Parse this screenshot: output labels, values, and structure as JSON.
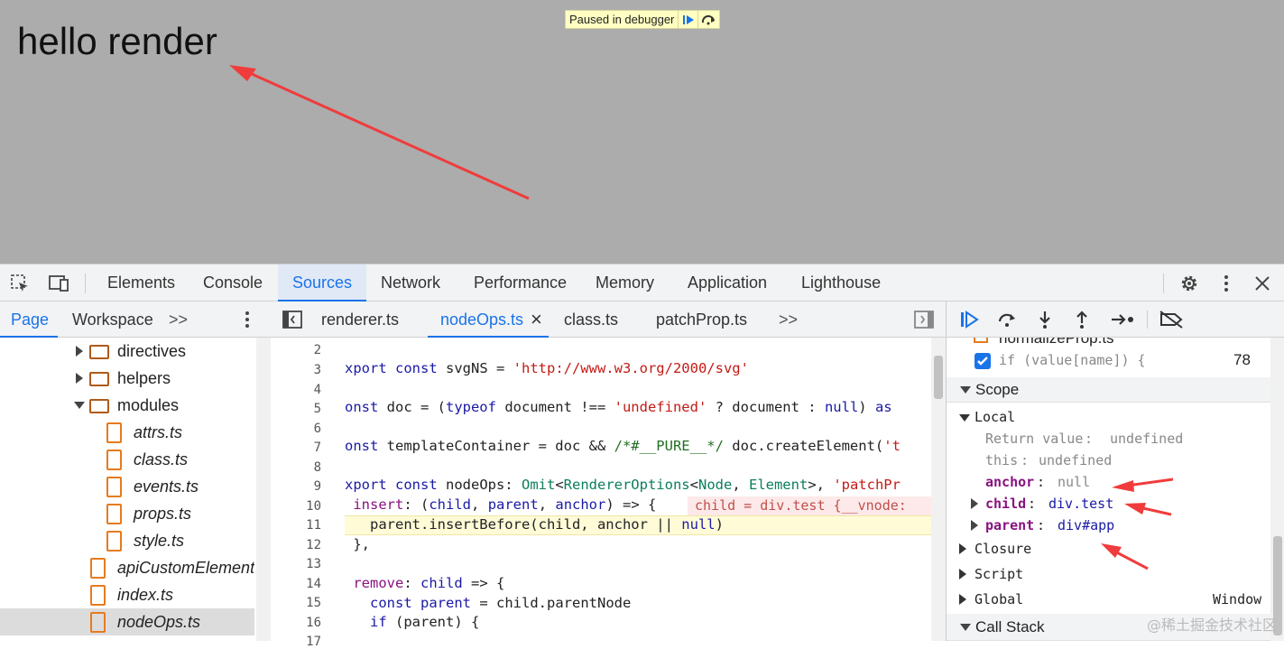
{
  "page": {
    "heading": "hello render"
  },
  "pause_banner": {
    "text": "Paused in debugger",
    "resume_icon": "resume-icon",
    "step_icon": "step-over-icon"
  },
  "devtools": {
    "tabs": [
      "Elements",
      "Console",
      "Sources",
      "Network",
      "Performance",
      "Memory",
      "Application",
      "Lighthouse"
    ],
    "active_tab": "Sources",
    "icons": [
      "inspect-element-icon",
      "device-toggle-icon",
      "settings-icon",
      "more-icon",
      "close-icon"
    ]
  },
  "navigator": {
    "tabs": [
      "Page",
      "Workspace"
    ],
    "active_tab": "Page",
    "more": ">>",
    "tree": [
      {
        "label": "directives",
        "kind": "folder",
        "expanded": false
      },
      {
        "label": "helpers",
        "kind": "folder",
        "expanded": false
      },
      {
        "label": "modules",
        "kind": "folder",
        "expanded": true
      },
      {
        "label": "attrs.ts",
        "kind": "file"
      },
      {
        "label": "class.ts",
        "kind": "file"
      },
      {
        "label": "events.ts",
        "kind": "file"
      },
      {
        "label": "props.ts",
        "kind": "file"
      },
      {
        "label": "style.ts",
        "kind": "file"
      },
      {
        "label": "apiCustomElement.t",
        "kind": "file"
      },
      {
        "label": "index.ts",
        "kind": "file"
      },
      {
        "label": "nodeOps.ts",
        "kind": "file",
        "selected": true
      }
    ]
  },
  "editor": {
    "tabs": [
      "renderer.ts",
      "nodeOps.ts",
      "class.ts",
      "patchProp.ts"
    ],
    "active_tab": "nodeOps.ts",
    "close_glyph": "×",
    "more": ">>",
    "line_numbers": [
      "2",
      "3",
      "4",
      "5",
      "6",
      "7",
      "8",
      "9",
      "10",
      "11",
      "12",
      "13",
      "14",
      "15",
      "16",
      "17"
    ],
    "inline_value": "child = div.test {__vnode:"
  },
  "debugger": {
    "breakpoint_file": "normalizeProp.ts",
    "breakpoint_code": "if (value[name]) {",
    "breakpoint_line": "78",
    "scope_title": "Scope",
    "local_title": "Local",
    "locals": [
      {
        "key": "Return value",
        "value": "undefined"
      },
      {
        "key": "this",
        "value": "undefined"
      },
      {
        "key": "anchor",
        "value": "null"
      },
      {
        "key": "child",
        "value": "div.test"
      },
      {
        "key": "parent",
        "value": "div#app"
      }
    ],
    "closure": "Closure",
    "script": "Script",
    "global": "Global",
    "global_value": "Window",
    "call_stack": "Call Stack"
  },
  "watermark": "@稀土掘金技术社区",
  "colors": {
    "accent": "#1a73e8",
    "annotation_arrow": "#f03c3c",
    "viewport_bg": "#acacac"
  }
}
